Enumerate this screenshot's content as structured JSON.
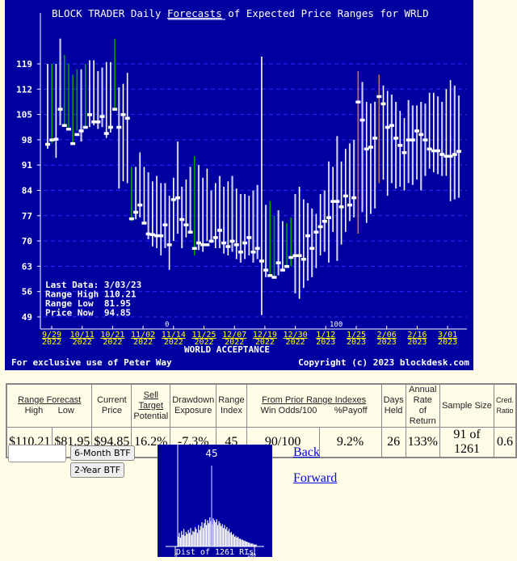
{
  "chart_data": {
    "type": "range-bar",
    "title_prefix": "BLOCK TRADER Daily ",
    "title_link": "Forecasts",
    "title_suffix": " of Expected Price Ranges for  WRLD",
    "company": "WORLD ACCEPTANCE",
    "ylim": [
      49,
      126
    ],
    "y_ticks": [
      119,
      112,
      105,
      98,
      91,
      84,
      77,
      70,
      63,
      56,
      49
    ],
    "x_ticks": [
      {
        "line1": "9/29",
        "line2": "2022"
      },
      {
        "line1": "10/11",
        "line2": "2022"
      },
      {
        "line1": "10/21",
        "line2": "2022"
      },
      {
        "line1": "11/02",
        "line2": "2022"
      },
      {
        "line1": "11/14",
        "line2": "2022"
      },
      {
        "line1": "11/25",
        "line2": "2022"
      },
      {
        "line1": "12/07",
        "line2": "2022"
      },
      {
        "line1": "12/19",
        "line2": "2022"
      },
      {
        "line1": "12/30",
        "line2": "2022"
      },
      {
        "line1": "1/12",
        "line2": "2023"
      },
      {
        "line1": "1/25",
        "line2": "2023"
      },
      {
        "line1": "2/06",
        "line2": "2023"
      },
      {
        "line1": "2/16",
        "line2": "2023"
      },
      {
        "line1": "3/01",
        "line2": "2023"
      }
    ],
    "axis_markers": [
      "0",
      "100"
    ],
    "info_box": [
      {
        "label": "Last Data:",
        "value": "3/03/23"
      },
      {
        "label": "Range High",
        "value": "110.21"
      },
      {
        "label": "Range Low ",
        "value": "81.95"
      },
      {
        "label": "Price Now ",
        "value": "94.85"
      }
    ],
    "footer_left": "For exclusive use of Peter Way",
    "footer_right": "Copyright (c) 2023 blockdesk.com",
    "colors": {
      "background": "#0000a0",
      "grid": "#2a2aff",
      "bar_white": "#ffffff",
      "bar_light": "#c8c8f0",
      "bar_green": "#00a000",
      "bar_orange": "#c08020",
      "tick_label": "#ffff00"
    },
    "bars": [
      {
        "hi": 119,
        "lo": 95.5,
        "p": 96.8,
        "c": "w"
      },
      {
        "hi": 119,
        "lo": 97,
        "p": 98,
        "c": "g"
      },
      {
        "hi": 119,
        "lo": 93,
        "p": 98.2,
        "c": "w"
      },
      {
        "hi": 126,
        "lo": 102,
        "p": 106.5,
        "c": "l"
      },
      {
        "hi": 121.5,
        "lo": 102,
        "p": 102,
        "c": "g"
      },
      {
        "hi": 119,
        "lo": 101,
        "p": 101,
        "c": "g"
      },
      {
        "hi": 116,
        "lo": 97,
        "p": 97,
        "c": "g"
      },
      {
        "hi": 117.5,
        "lo": 100.5,
        "p": 99.5,
        "c": "g"
      },
      {
        "hi": 117.5,
        "lo": 97.5,
        "p": 100.5,
        "c": "l"
      },
      {
        "hi": 119,
        "lo": 101,
        "p": 101.5,
        "c": "g"
      },
      {
        "hi": 120,
        "lo": 101.5,
        "p": 105,
        "c": "w"
      },
      {
        "hi": 120,
        "lo": 102,
        "p": 103,
        "c": "w"
      },
      {
        "hi": 117,
        "lo": 101,
        "p": 103,
        "c": "l"
      },
      {
        "hi": 118,
        "lo": 101.5,
        "p": 104.5,
        "c": "l"
      },
      {
        "hi": 119.5,
        "lo": 98.5,
        "p": 99.8,
        "c": "w"
      },
      {
        "hi": 119.5,
        "lo": 100,
        "p": 101.5,
        "c": "w"
      },
      {
        "hi": 126,
        "lo": 106,
        "p": 106.5,
        "c": "g"
      },
      {
        "hi": 112.5,
        "lo": 84.5,
        "p": 101.5,
        "c": "l"
      },
      {
        "hi": 113.5,
        "lo": 86.5,
        "p": 105,
        "c": "w"
      },
      {
        "hi": 116.5,
        "lo": 86,
        "p": 104,
        "c": "w"
      },
      {
        "hi": 90.5,
        "lo": 75.5,
        "p": 76.2,
        "c": "g"
      },
      {
        "hi": 90.5,
        "lo": 76,
        "p": 78,
        "c": "l"
      },
      {
        "hi": 94.5,
        "lo": 76.5,
        "p": 80,
        "c": "w"
      },
      {
        "hi": 90.5,
        "lo": 75,
        "p": 75,
        "c": "w"
      },
      {
        "hi": 89,
        "lo": 70.5,
        "p": 72,
        "c": "l"
      },
      {
        "hi": 86.5,
        "lo": 68.5,
        "p": 71.8,
        "c": "w"
      },
      {
        "hi": 88,
        "lo": 68,
        "p": 71.5,
        "c": "w"
      },
      {
        "hi": 86,
        "lo": 66,
        "p": 71.5,
        "c": "w"
      },
      {
        "hi": 86,
        "lo": 68,
        "p": 74.5,
        "c": "l"
      },
      {
        "hi": 82.5,
        "lo": 62,
        "p": 69,
        "c": "w"
      },
      {
        "hi": 87.5,
        "lo": 70,
        "p": 81.5,
        "c": "w"
      },
      {
        "hi": 97.5,
        "lo": 72,
        "p": 82,
        "c": "l"
      },
      {
        "hi": 85,
        "lo": 68,
        "p": 76,
        "c": "l"
      },
      {
        "hi": 87,
        "lo": 71,
        "p": 74.5,
        "c": "w"
      },
      {
        "hi": 90.5,
        "lo": 72,
        "p": 72.5,
        "c": "l"
      },
      {
        "hi": 93.5,
        "lo": 66,
        "p": 68,
        "c": "g"
      },
      {
        "hi": 91,
        "lo": 67.5,
        "p": 69.5,
        "c": "l"
      },
      {
        "hi": 87.5,
        "lo": 67,
        "p": 69,
        "c": "w"
      },
      {
        "hi": 90,
        "lo": 70,
        "p": 69,
        "c": "w"
      },
      {
        "hi": 84,
        "lo": 69.5,
        "p": 70,
        "c": "l"
      },
      {
        "hi": 86,
        "lo": 68,
        "p": 71,
        "c": "w"
      },
      {
        "hi": 88,
        "lo": 68,
        "p": 73,
        "c": "l"
      },
      {
        "hi": 85,
        "lo": 66.5,
        "p": 69.5,
        "c": "w"
      },
      {
        "hi": 86.5,
        "lo": 66,
        "p": 68.5,
        "c": "w"
      },
      {
        "hi": 88,
        "lo": 67,
        "p": 70,
        "c": "l"
      },
      {
        "hi": 84.5,
        "lo": 65,
        "p": 69,
        "c": "w"
      },
      {
        "hi": 83,
        "lo": 64,
        "p": 67,
        "c": "l"
      },
      {
        "hi": 83,
        "lo": 65,
        "p": 69.5,
        "c": "w"
      },
      {
        "hi": 82.5,
        "lo": 66,
        "p": 71,
        "c": "w"
      },
      {
        "hi": 84,
        "lo": 64,
        "p": 67,
        "c": "l"
      },
      {
        "hi": 85.5,
        "lo": 65,
        "p": 68,
        "c": "l"
      },
      {
        "hi": 121,
        "lo": 49.5,
        "p": 64.5,
        "c": "w"
      },
      {
        "hi": 80,
        "lo": 60,
        "p": 62,
        "c": "l"
      },
      {
        "hi": 81,
        "lo": 60,
        "p": 60.5,
        "c": "g"
      },
      {
        "hi": 77,
        "lo": 60,
        "p": 60,
        "c": "g"
      },
      {
        "hi": 78.5,
        "lo": 60.5,
        "p": 64,
        "c": "l"
      },
      {
        "hi": 75.5,
        "lo": 62,
        "p": 62,
        "c": "w"
      },
      {
        "hi": 75,
        "lo": 63,
        "p": 63,
        "c": "g"
      },
      {
        "hi": 76.5,
        "lo": 63,
        "p": 65.5,
        "c": "g"
      },
      {
        "hi": 83,
        "lo": 55.5,
        "p": 66,
        "c": "l"
      },
      {
        "hi": 85,
        "lo": 54,
        "p": 66,
        "c": "w"
      },
      {
        "hi": 81.5,
        "lo": 57,
        "p": 65,
        "c": "w"
      },
      {
        "hi": 80.5,
        "lo": 59,
        "p": 71.5,
        "c": "l"
      },
      {
        "hi": 79,
        "lo": 60,
        "p": 68,
        "c": "l"
      },
      {
        "hi": 77.5,
        "lo": 62.5,
        "p": 72.5,
        "c": "w"
      },
      {
        "hi": 83,
        "lo": 66,
        "p": 74,
        "c": "w"
      },
      {
        "hi": 84,
        "lo": 67,
        "p": 75.5,
        "c": "l"
      },
      {
        "hi": 92,
        "lo": 64,
        "p": 76.5,
        "c": "w"
      },
      {
        "hi": 90.5,
        "lo": 72.5,
        "p": 81,
        "c": "w"
      },
      {
        "hi": 99,
        "lo": 64.5,
        "p": 81,
        "c": "l"
      },
      {
        "hi": 92,
        "lo": 69,
        "p": 79.5,
        "c": "w"
      },
      {
        "hi": 95.5,
        "lo": 72.5,
        "p": 82.5,
        "c": "w"
      },
      {
        "hi": 97,
        "lo": 75.5,
        "p": 80,
        "c": "l"
      },
      {
        "hi": 98,
        "lo": 76.5,
        "p": 82,
        "c": "l"
      },
      {
        "hi": 117,
        "lo": 72,
        "p": 108.5,
        "c": "o"
      },
      {
        "hi": 114,
        "lo": 78,
        "p": 103.5,
        "c": "l"
      },
      {
        "hi": 108.5,
        "lo": 75,
        "p": 95.5,
        "c": "w"
      },
      {
        "hi": 108,
        "lo": 77.5,
        "p": 96,
        "c": "w"
      },
      {
        "hi": 108.5,
        "lo": 79,
        "p": 98.5,
        "c": "l"
      },
      {
        "hi": 116,
        "lo": 86,
        "p": 110,
        "c": "o"
      },
      {
        "hi": 113,
        "lo": 87,
        "p": 108,
        "c": "w"
      },
      {
        "hi": 111.5,
        "lo": 82.5,
        "p": 101.5,
        "c": "w"
      },
      {
        "hi": 110.5,
        "lo": 86,
        "p": 102,
        "c": "l"
      },
      {
        "hi": 108.5,
        "lo": 84.5,
        "p": 98.5,
        "c": "l"
      },
      {
        "hi": 106,
        "lo": 85,
        "p": 96.5,
        "c": "w"
      },
      {
        "hi": 104,
        "lo": 84,
        "p": 94.5,
        "c": "w"
      },
      {
        "hi": 109,
        "lo": 86,
        "p": 98,
        "c": "l"
      },
      {
        "hi": 107.5,
        "lo": 85.5,
        "p": 98,
        "c": "l"
      },
      {
        "hi": 107.5,
        "lo": 87,
        "p": 100.5,
        "c": "w"
      },
      {
        "hi": 108.5,
        "lo": 84,
        "p": 99.5,
        "c": "l"
      },
      {
        "hi": 108,
        "lo": 88,
        "p": 98,
        "c": "l"
      },
      {
        "hi": 111,
        "lo": 90,
        "p": 95.5,
        "c": "w"
      },
      {
        "hi": 111,
        "lo": 89,
        "p": 95,
        "c": "w"
      },
      {
        "hi": 110,
        "lo": 88.5,
        "p": 95,
        "c": "l"
      },
      {
        "hi": 108.5,
        "lo": 88,
        "p": 94,
        "c": "l"
      },
      {
        "hi": 112,
        "lo": 88,
        "p": 93.5,
        "c": "w"
      },
      {
        "hi": 114.5,
        "lo": 81,
        "p": 93.5,
        "c": "w"
      },
      {
        "hi": 113,
        "lo": 81.5,
        "p": 94,
        "c": "l"
      },
      {
        "hi": 110.21,
        "lo": 81.95,
        "p": 94.85,
        "c": "l"
      }
    ]
  },
  "table": {
    "headers": {
      "range_forecast": "Range Forecast",
      "high": "High",
      "low": "Low",
      "current": "Current",
      "price": "Price",
      "sell_target": "Sell Target",
      "potential": "Potential",
      "drawdown": "Drawdown",
      "exposure": "Exposure",
      "range": "Range",
      "index": "Index",
      "from_prior": "From Prior Range Indexes",
      "win_odds": "Win Odds/100",
      "payoff": "%Payoff",
      "days": "Days",
      "held": "Held",
      "annual_rate": "Annual Rate",
      "of_return": "of Return",
      "sample_size": "Sample Size",
      "cred": "Cred.",
      "ratio": "Ratio"
    },
    "values": {
      "high": "$110.21",
      "low": "$81.95",
      "price": "$94.85",
      "potential": "16.2%",
      "exposure": "-7.3%",
      "index": "45",
      "win_odds": "90/100",
      "payoff": "9.2%",
      "held": "26",
      "annual_return": "133%",
      "sample_size": "91 of 1261",
      "cred_ratio": "0.6"
    }
  },
  "controls": {
    "symbol_input_value": "",
    "six_month_btf": "6-Month BTF",
    "two_year_btf": "2-Year BTF",
    "back": "Back",
    "forward": "Forward"
  },
  "histogram": {
    "current_index": "45",
    "caption": "Dist of 1261 RIs",
    "axis_min": "0",
    "axis_max": "100"
  }
}
